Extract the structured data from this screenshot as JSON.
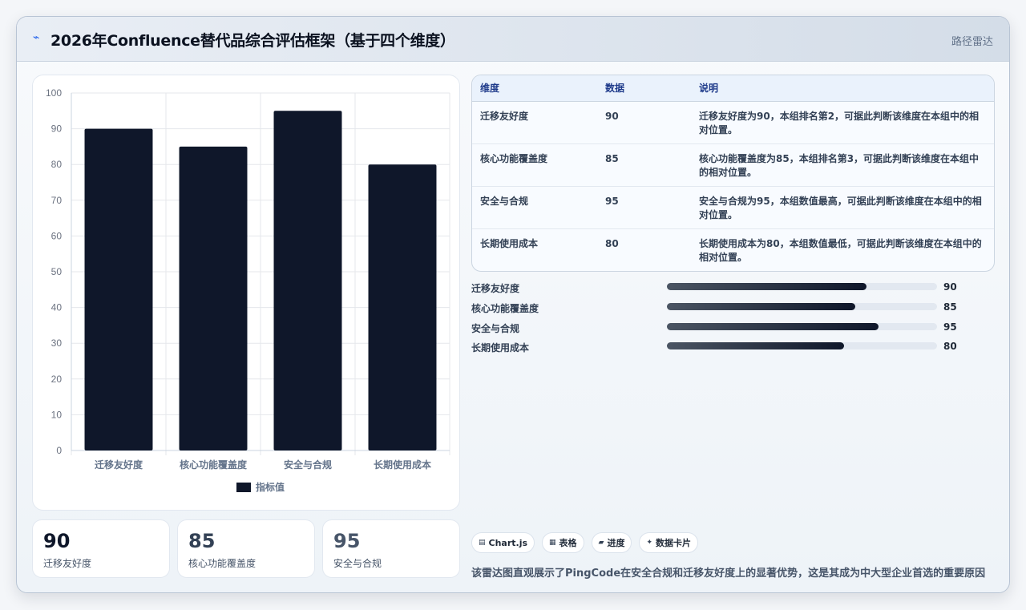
{
  "header": {
    "logo_icon": "spark-icon",
    "title": "2026年Confluence替代品综合评估框架（基于四个维度）",
    "tag": "路径雷达"
  },
  "chart_data": {
    "type": "bar",
    "categories": [
      "迁移友好度",
      "核心功能覆盖度",
      "安全与合规",
      "长期使用成本"
    ],
    "series": [
      {
        "name": "指标值",
        "values": [
          90,
          85,
          95,
          80
        ],
        "color": "#0f172a"
      }
    ],
    "ylim": [
      0,
      100
    ],
    "yticks": [
      0,
      10,
      20,
      30,
      40,
      50,
      60,
      70,
      80,
      90,
      100
    ],
    "grid": true,
    "legend": "bottom"
  },
  "stats": [
    {
      "value": "90",
      "label": "迁移友好度",
      "color": "#0f172a"
    },
    {
      "value": "85",
      "label": "核心功能覆盖度",
      "color": "#334155"
    },
    {
      "value": "95",
      "label": "安全与合规",
      "color": "#475569"
    }
  ],
  "table": {
    "headers": [
      "维度",
      "数据",
      "说明"
    ],
    "rows": [
      {
        "name": "迁移友好度",
        "value": "90",
        "desc": "迁移友好度为90，本组排名第2，可据此判断该维度在本组中的相对位置。"
      },
      {
        "name": "核心功能覆盖度",
        "value": "85",
        "desc": "核心功能覆盖度为85，本组排名第3，可据此判断该维度在本组中的相对位置。"
      },
      {
        "name": "安全与合规",
        "value": "95",
        "desc": "安全与合规为95，本组数值最高，可据此判断该维度在本组中的相对位置。"
      },
      {
        "name": "长期使用成本",
        "value": "80",
        "desc": "长期使用成本为80，本组数值最低，可据此判断该维度在本组中的相对位置。"
      }
    ]
  },
  "progress": [
    {
      "label": "迁移友好度",
      "value": "90",
      "fraction": 0.74
    },
    {
      "label": "核心功能覆盖度",
      "value": "85",
      "fraction": 0.698
    },
    {
      "label": "安全与合规",
      "value": "95",
      "fraction": 0.782
    },
    {
      "label": "长期使用成本",
      "value": "80",
      "fraction": 0.656
    }
  ],
  "chips": [
    {
      "icon": "chart-icon",
      "glyph": "▤",
      "label": "Chart.js"
    },
    {
      "icon": "table-icon",
      "glyph": "▦",
      "label": "表格"
    },
    {
      "icon": "progress-icon",
      "glyph": "▰",
      "label": "进度"
    },
    {
      "icon": "card-icon",
      "glyph": "✦",
      "label": "数据卡片"
    }
  ],
  "caption": "该雷达图直观展示了PingCode在安全合规和迁移友好度上的显著优势，这是其成为中大型企业首选的重要原因"
}
